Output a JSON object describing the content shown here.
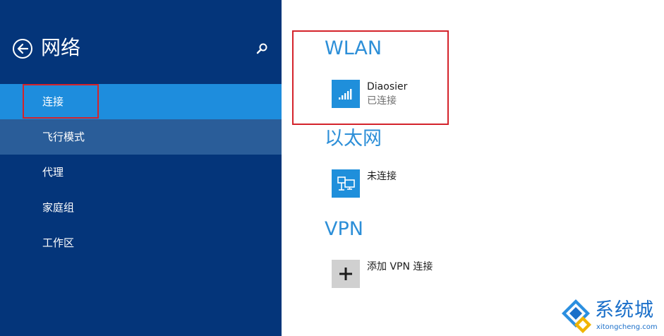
{
  "sidebar": {
    "title": "网络",
    "back_icon": "back-arrow-icon",
    "search_icon": "search-icon",
    "items": [
      {
        "label": "连接",
        "state": "selected"
      },
      {
        "label": "飞行模式",
        "state": "hover"
      },
      {
        "label": "代理",
        "state": "normal"
      },
      {
        "label": "家庭组",
        "state": "normal"
      },
      {
        "label": "工作区",
        "state": "normal"
      }
    ]
  },
  "wlan": {
    "title": "WLAN",
    "network_name": "Diaosier",
    "network_status": "已连接",
    "icon": "wifi-signal-icon"
  },
  "ethernet": {
    "title": "以太网",
    "status": "未连接",
    "icon": "ethernet-icon"
  },
  "vpn": {
    "title": "VPN",
    "add_label": "添加 VPN 连接",
    "icon": "plus-icon"
  },
  "watermark": {
    "brand": "系统城",
    "url": "xitongcheng.com"
  },
  "colors": {
    "sidebar_bg": "#04357a",
    "selected_bg": "#1e8ddd",
    "hover_bg": "#2a5d99",
    "accent": "#2d8fd8",
    "highlight": "#d4232b"
  }
}
